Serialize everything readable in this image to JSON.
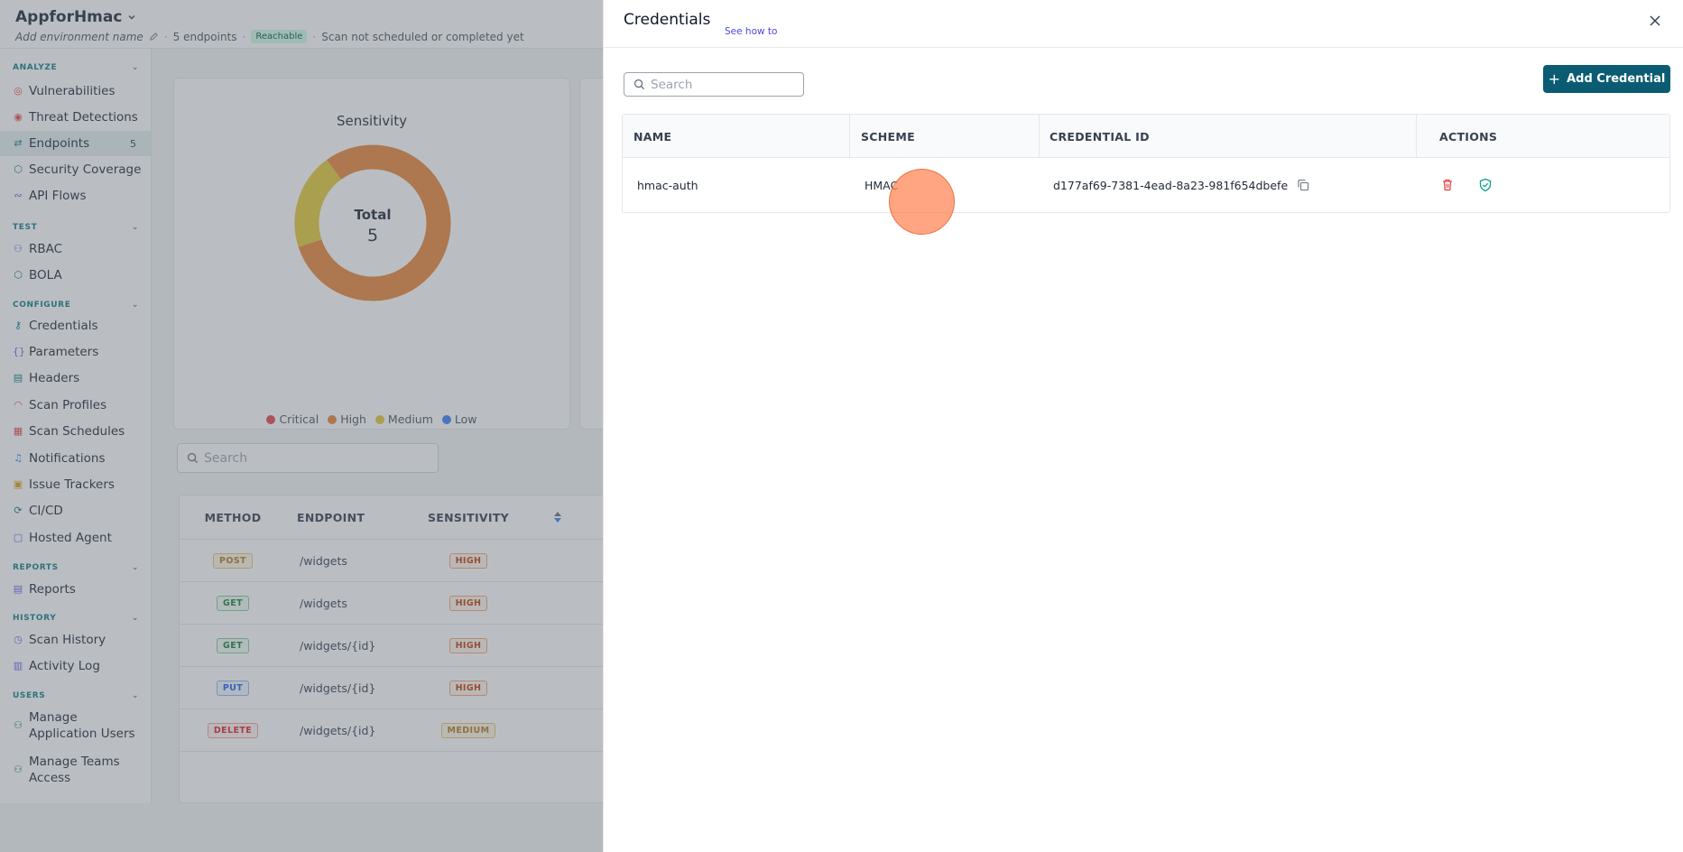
{
  "app": {
    "env_name": "AppforHmac",
    "env_placeholder": "Add environment name",
    "endpoint_count": "5 endpoints",
    "status_badge": "Reachable",
    "scan_status": "Scan not scheduled or completed yet"
  },
  "sidebar": {
    "sections": [
      {
        "label": "ANALYZE"
      },
      {
        "label": "TEST"
      },
      {
        "label": "CONFIGURE"
      },
      {
        "label": "REPORTS"
      },
      {
        "label": "HISTORY"
      },
      {
        "label": "USERS"
      }
    ],
    "items": [
      {
        "label": "Vulnerabilities",
        "icon": "shield-alert-icon"
      },
      {
        "label": "Threat Detections",
        "icon": "target-icon"
      },
      {
        "label": "Endpoints",
        "icon": "endpoints-icon",
        "count": "5",
        "active": true
      },
      {
        "label": "Security Coverage",
        "icon": "shield-icon"
      },
      {
        "label": "API Flows",
        "icon": "flow-icon"
      },
      {
        "label": "RBAC",
        "icon": "users-icon"
      },
      {
        "label": "BOLA",
        "icon": "shield-check-icon"
      },
      {
        "label": "Credentials",
        "icon": "key-icon"
      },
      {
        "label": "Parameters",
        "icon": "braces-icon"
      },
      {
        "label": "Headers",
        "icon": "table-icon"
      },
      {
        "label": "Scan Profiles",
        "icon": "gauge-icon"
      },
      {
        "label": "Scan Schedules",
        "icon": "calendar-icon"
      },
      {
        "label": "Notifications",
        "icon": "bell-icon"
      },
      {
        "label": "Issue Trackers",
        "icon": "tracker-icon"
      },
      {
        "label": "CI/CD",
        "icon": "pipeline-icon"
      },
      {
        "label": "Hosted Agent",
        "icon": "agent-icon"
      },
      {
        "label": "Reports",
        "icon": "report-icon"
      },
      {
        "label": "Scan History",
        "icon": "history-icon"
      },
      {
        "label": "Activity Log",
        "icon": "log-icon"
      },
      {
        "label": "Manage Application Users",
        "line1": "Manage",
        "line2": "Application Users",
        "icon": "user-icon"
      },
      {
        "label": "Manage Teams Access",
        "line1": "Manage Teams",
        "line2": "Access",
        "icon": "team-icon"
      }
    ]
  },
  "sensitivity_card": {
    "title": "Sensitivity",
    "center_label": "Total",
    "center_value": "5",
    "legend": [
      {
        "label": "Critical",
        "color": "#e5484d"
      },
      {
        "label": "High",
        "color": "#e9863a"
      },
      {
        "label": "Medium",
        "color": "#e3c93a"
      },
      {
        "label": "Low",
        "color": "#3b82f6"
      }
    ],
    "segments": [
      {
        "label": "High",
        "value": 4,
        "color": "#e9863a"
      },
      {
        "label": "Medium",
        "value": 1,
        "color": "#e3c93a"
      }
    ]
  },
  "endpoints": {
    "search_placeholder": "Search",
    "headers": {
      "method": "METHOD",
      "endpoint": "ENDPOINT",
      "sensitivity": "SENSITIVITY"
    },
    "rows": [
      {
        "method": "POST",
        "path": "/widgets",
        "sensitivity": "HIGH"
      },
      {
        "method": "GET",
        "path": "/widgets",
        "sensitivity": "HIGH"
      },
      {
        "method": "GET",
        "path": "/widgets/{id}",
        "sensitivity": "HIGH"
      },
      {
        "method": "PUT",
        "path": "/widgets/{id}",
        "sensitivity": "HIGH"
      },
      {
        "method": "DELETE",
        "path": "/widgets/{id}",
        "sensitivity": "MEDIUM"
      }
    ]
  },
  "drawer": {
    "title": "Credentials",
    "see_how": "See how to",
    "search_placeholder": "Search",
    "add_button": "Add Credential",
    "table": {
      "headers": {
        "name": "NAME",
        "scheme": "SCHEME",
        "credential_id": "CREDENTIAL ID",
        "actions": "ACTIONS"
      },
      "rows": [
        {
          "name": "hmac-auth",
          "scheme": "HMAC",
          "credential_id": "d177af69-7381-4ead-8a23-981f654dbefe"
        }
      ]
    }
  },
  "colors": {
    "brand": "#0b5c73",
    "accent": "#0e7c86",
    "link": "#4f46e5",
    "danger": "#e5484d",
    "click_marker": "#ff8250"
  }
}
